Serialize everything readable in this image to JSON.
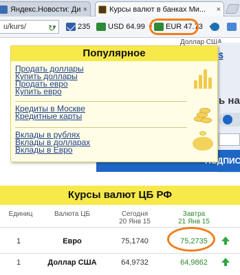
{
  "browser": {
    "tabs": [
      {
        "title": "Яндекс.Новости: Динами",
        "close": "×"
      },
      {
        "title": "Курсы валют в банках Ми...",
        "close": "×"
      }
    ],
    "address": "u/kurs/",
    "toolbar": {
      "mail_count": "235",
      "usd": "USD 64.99",
      "eur": "EUR 47.73"
    }
  },
  "page": {
    "dollar_label": "Доллар США",
    "nav_fragment": "$",
    "side_fragment": "ь на",
    "button_fragment": "ПОДПИС"
  },
  "menu": {
    "title": "Популярное",
    "groups": [
      [
        "Продать доллары",
        "Купить доллары",
        "Продать евро",
        "Купить евро"
      ],
      [
        "Кредиты в Москве",
        "Кредитные карты"
      ],
      [
        "Вклады в рублях",
        "Вклады в долларах",
        "Вклады в Евро"
      ]
    ]
  },
  "rates": {
    "title": "Курсы валют ЦБ РФ",
    "headers": {
      "unit": "Единиц",
      "currency": "Валюта ЦБ",
      "today": "Сегодня",
      "today_date": "20 Янв 15",
      "tomorrow": "Завтра",
      "tomorrow_date": "21 Янв 15"
    },
    "rows": [
      {
        "unit": "1",
        "currency": "Евро",
        "today": "75,1740",
        "tomorrow": "75,2735",
        "trend": "up"
      },
      {
        "unit": "1",
        "currency": "Доллар США",
        "today": "64,9732",
        "tomorrow": "64,9862",
        "trend": "up"
      }
    ]
  },
  "colors": {
    "accent_yellow": "#f7e94a",
    "highlight_orange": "#f07d1c",
    "link_blue": "#1b3f8b",
    "up_green": "#2fa640"
  }
}
